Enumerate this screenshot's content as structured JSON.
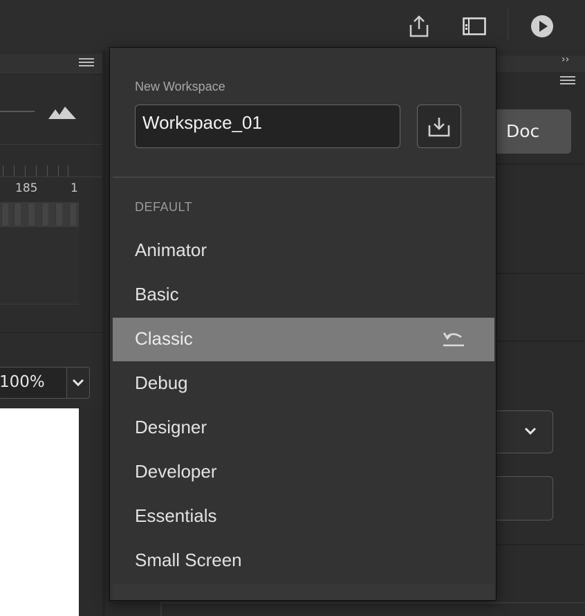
{
  "toolbar": {
    "publish_icon": "share-export-icon",
    "workspace_icon": "workspace-layout-icon",
    "play_icon": "play-icon"
  },
  "timeline": {
    "frame_number": "185",
    "frame_number_partial": "1"
  },
  "stage": {
    "zoom": "100%"
  },
  "properties": {
    "doc_tab": "Doc"
  },
  "workspace_popover": {
    "new_label": "New Workspace",
    "name_value": "Workspace_01",
    "section_label": "DEFAULT",
    "items": [
      {
        "label": "Animator"
      },
      {
        "label": "Basic"
      },
      {
        "label": "Classic"
      },
      {
        "label": "Debug"
      },
      {
        "label": "Designer"
      },
      {
        "label": "Developer"
      },
      {
        "label": "Essentials"
      },
      {
        "label": "Small Screen"
      }
    ],
    "selected": "Classic"
  },
  "colors": {
    "background": "#2b2b2b",
    "popover": "#333333",
    "selected_row": "#7b7b7b",
    "doc_button": "#505050"
  }
}
